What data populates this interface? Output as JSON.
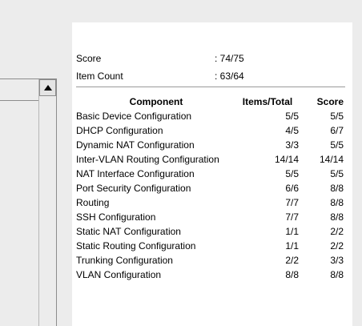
{
  "summary": {
    "score_label": "Score",
    "score_value": ": 74/75",
    "item_count_label": "Item Count",
    "item_count_value": ": 63/64"
  },
  "table": {
    "headers": {
      "component": "Component",
      "items": "Items/Total",
      "score": "Score"
    },
    "rows": [
      {
        "component": "Basic Device Configuration",
        "items": "5/5",
        "score": "5/5"
      },
      {
        "component": "DHCP Configuration",
        "items": "4/5",
        "score": "6/7"
      },
      {
        "component": "Dynamic NAT Configuration",
        "items": "3/3",
        "score": "5/5"
      },
      {
        "component": "Inter-VLAN Routing Configuration",
        "items": "14/14",
        "score": "14/14"
      },
      {
        "component": "NAT Interface Configuration",
        "items": "5/5",
        "score": "5/5"
      },
      {
        "component": "Port Security Configuration",
        "items": "6/6",
        "score": "8/8"
      },
      {
        "component": "Routing",
        "items": "7/7",
        "score": "8/8"
      },
      {
        "component": "SSH Configuration",
        "items": "7/7",
        "score": "8/8"
      },
      {
        "component": "Static NAT Configuration",
        "items": "1/1",
        "score": "2/2"
      },
      {
        "component": "Static Routing Configuration",
        "items": "1/1",
        "score": "2/2"
      },
      {
        "component": "Trunking Configuration",
        "items": "2/2",
        "score": "3/3"
      },
      {
        "component": "VLAN Configuration",
        "items": "8/8",
        "score": "8/8"
      }
    ]
  },
  "icons": {
    "scroll_up": "triangle-up-icon"
  },
  "colors": {
    "panel_background": "#ffffff",
    "window_background": "#ececec",
    "border": "#8c8c8c"
  }
}
